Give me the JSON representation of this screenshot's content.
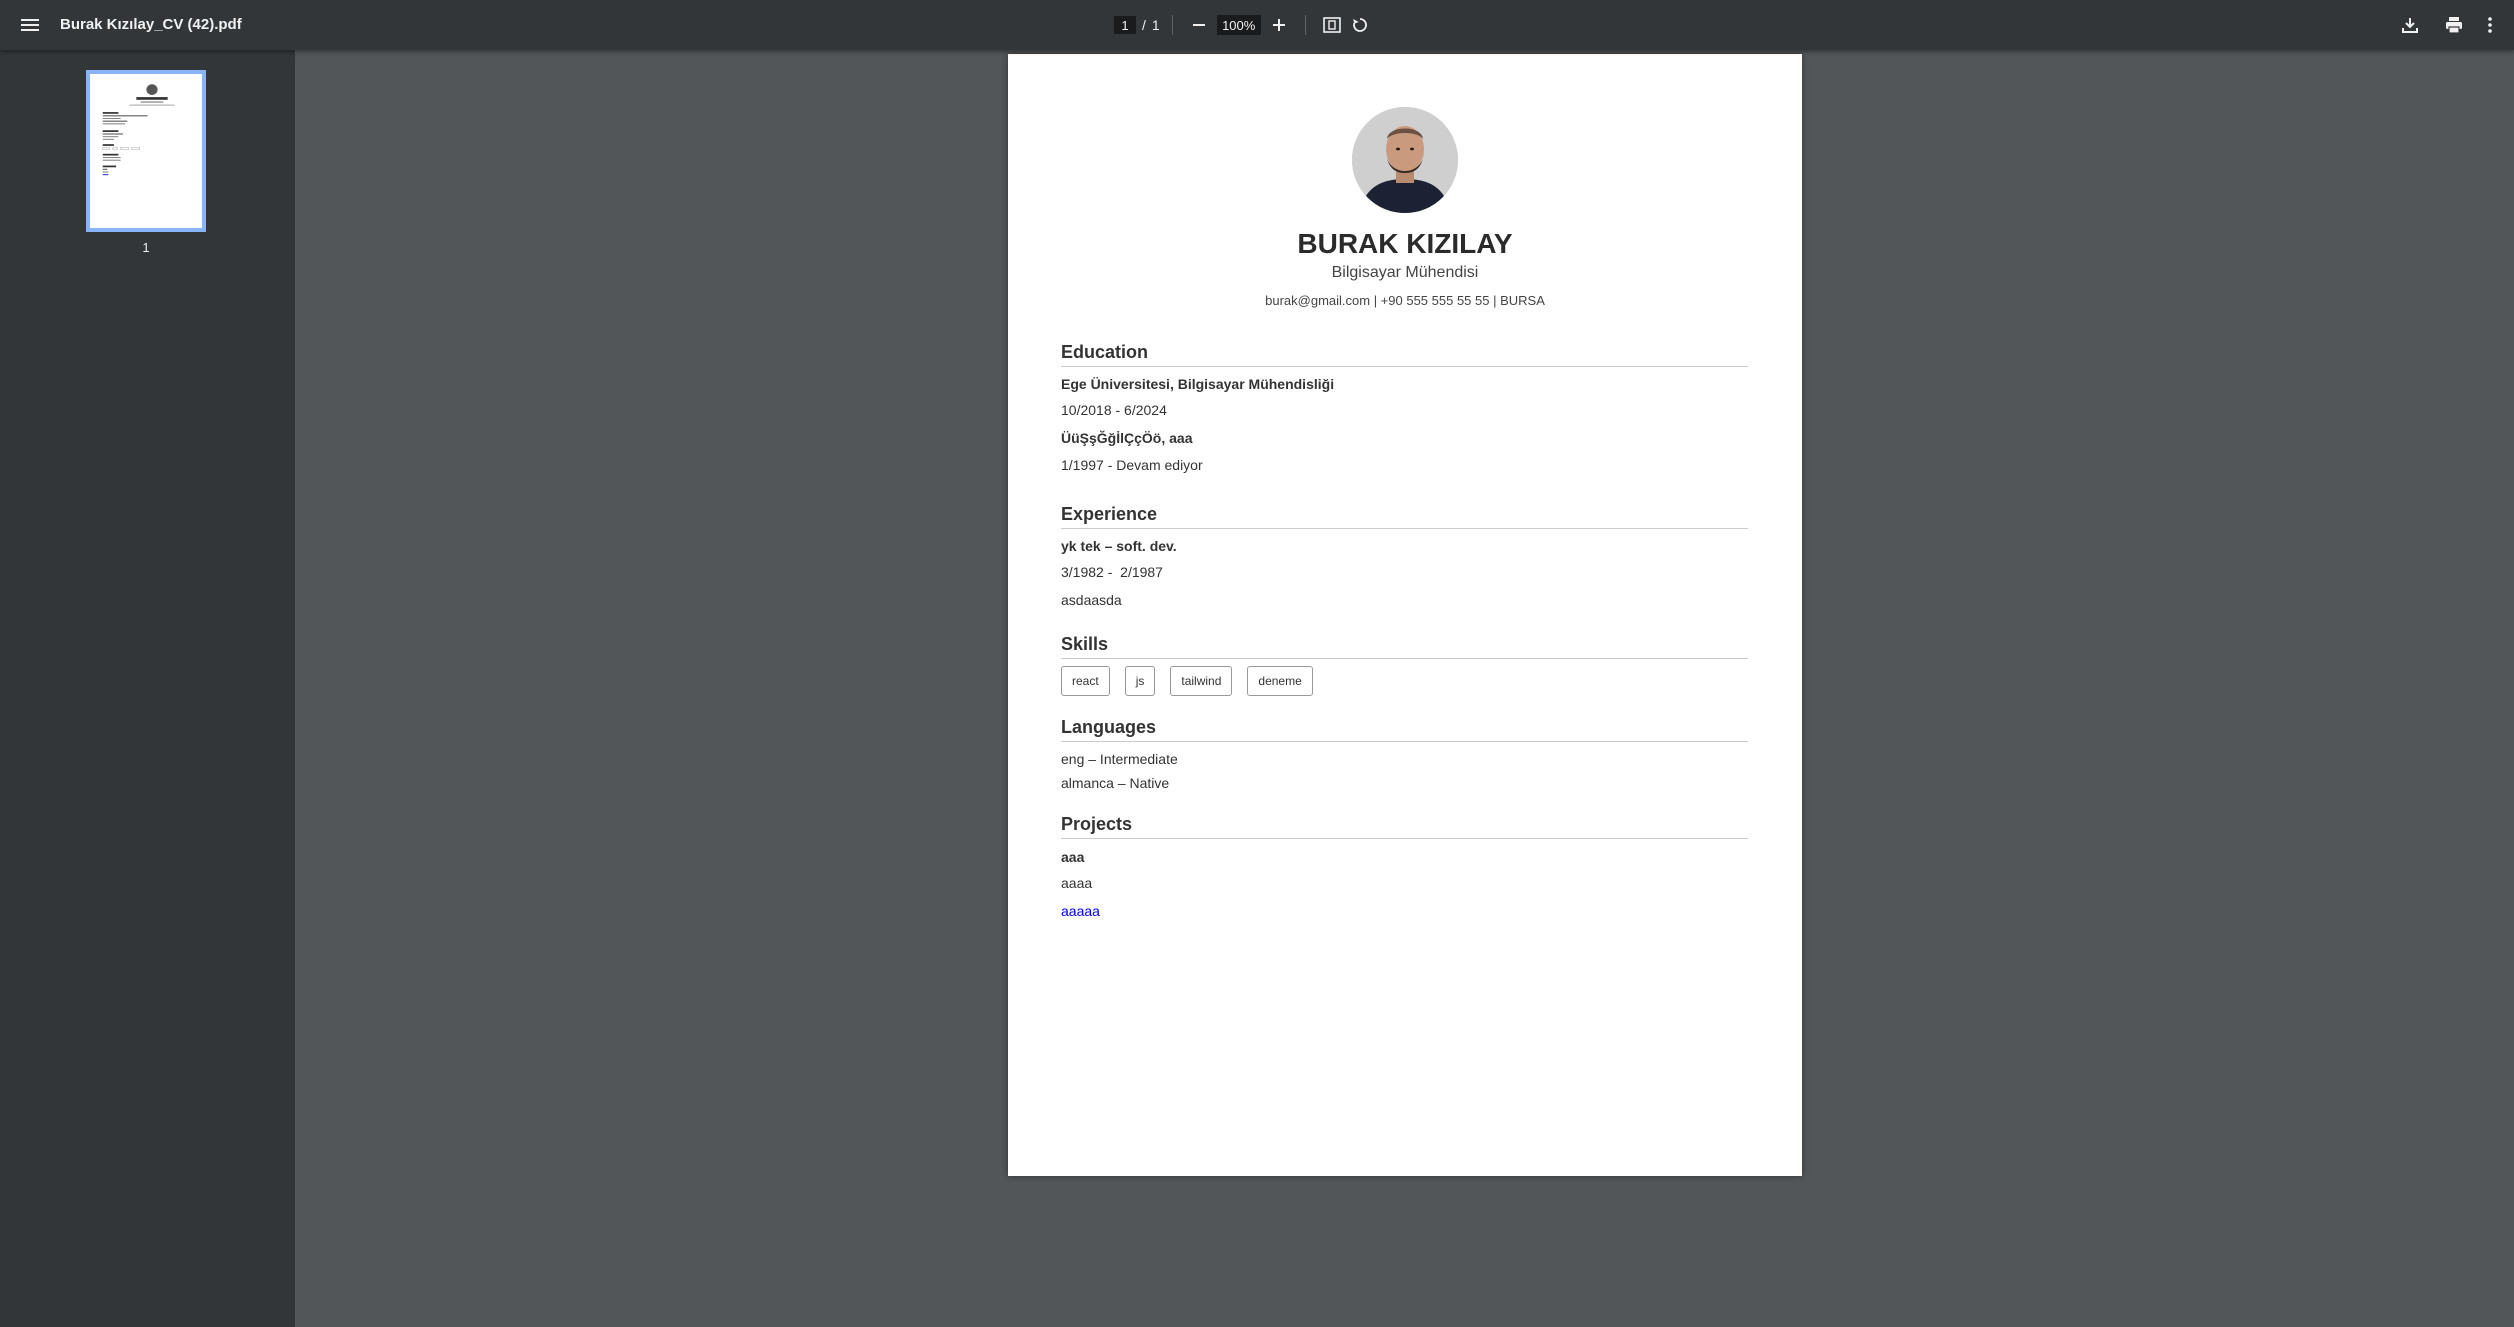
{
  "toolbar": {
    "file_name": "Burak Kızılay_CV (42).pdf",
    "current_page": "1",
    "page_separator": "/",
    "total_pages": "1",
    "zoom": "100%",
    "zoom_out": "−",
    "zoom_in": "+"
  },
  "sidebar": {
    "thumbnail_label": "1"
  },
  "cv": {
    "name": "BURAK KIZILAY",
    "title": "Bilgisayar Mühendisi",
    "contact": "burak@gmail.com | +90 555 555 55 55 | BURSA",
    "education": {
      "heading": "Education",
      "items": [
        {
          "school": "Ege Üniversitesi, Bilgisayar Mühendisliği",
          "dates": "10/2018 - 6/2024"
        },
        {
          "school": "ÜüŞşĞğİlÇçÖö, aaa",
          "dates": "1/1997 - Devam ediyor"
        }
      ]
    },
    "experience": {
      "heading": "Experience",
      "items": [
        {
          "role": "yk tek – soft. dev.",
          "dates": "3/1982 -  2/1987",
          "description": "asdaasda"
        }
      ]
    },
    "skills": {
      "heading": "Skills",
      "items": [
        "react",
        "js",
        "tailwind",
        "deneme"
      ]
    },
    "languages": {
      "heading": "Languages",
      "items": [
        "eng – Intermediate",
        "almanca – Native"
      ]
    },
    "projects": {
      "heading": "Projects",
      "items": [
        {
          "name": "aaa",
          "description": "aaaa",
          "link": "aaaaa"
        }
      ]
    }
  },
  "colors": {
    "toolbar_bg": "#323639",
    "viewer_bg": "#525659",
    "thumb_border": "#8ab4f8",
    "link": "#0000ee"
  }
}
